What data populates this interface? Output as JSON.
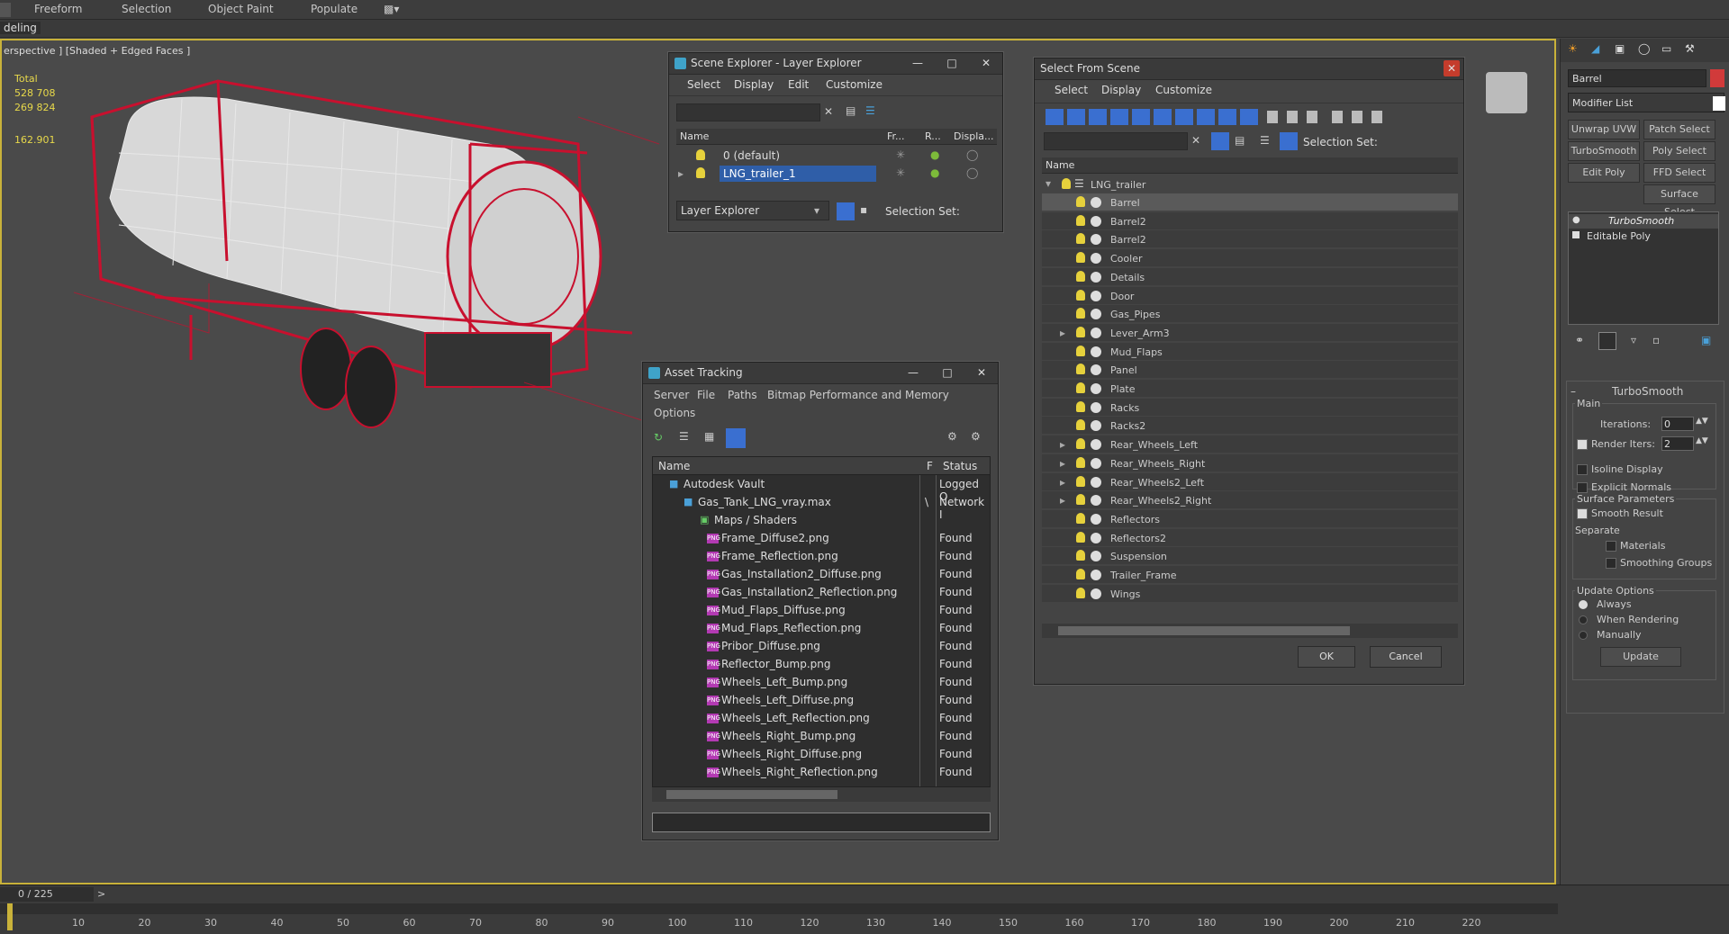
{
  "ribbon": {
    "tabs": [
      "Freeform",
      "Selection",
      "Object Paint",
      "Populate"
    ],
    "subtab": "deling"
  },
  "viewport": {
    "label": "erspective ] [Shaded + Edged Faces ]",
    "stats": {
      "total_label": "Total",
      "line1": "528 708",
      "line2": "269 824",
      "fps": "162.901"
    }
  },
  "scene_explorer": {
    "title": "Scene Explorer - Layer Explorer",
    "menu": [
      "Select",
      "Display",
      "Edit",
      "Customize"
    ],
    "columns": [
      "Name",
      "Fr...",
      "R...",
      "Displa..."
    ],
    "rows": [
      "0 (default)",
      "LNG_trailer_1"
    ],
    "footer_dropdown": "Layer Explorer",
    "selection_set": "Selection Set:"
  },
  "asset_tracking": {
    "title": "Asset Tracking",
    "menu": [
      "Server",
      "File",
      "Paths",
      "Bitmap Performance and Memory",
      "Options"
    ],
    "columns": [
      "Name",
      "F",
      "Status"
    ],
    "rows": [
      {
        "name": "Autodesk Vault",
        "f": "",
        "status": "Logged O"
      },
      {
        "name": "Gas_Tank_LNG_vray.max",
        "f": "\\",
        "status": "Network I"
      },
      {
        "name": "Maps / Shaders",
        "f": "",
        "status": ""
      },
      {
        "name": "Frame_Diffuse2.png",
        "f": "",
        "status": "Found"
      },
      {
        "name": "Frame_Reflection.png",
        "f": "",
        "status": "Found"
      },
      {
        "name": "Gas_Installation2_Diffuse.png",
        "f": "",
        "status": "Found"
      },
      {
        "name": "Gas_Installation2_Reflection.png",
        "f": "",
        "status": "Found"
      },
      {
        "name": "Mud_Flaps_Diffuse.png",
        "f": "",
        "status": "Found"
      },
      {
        "name": "Mud_Flaps_Reflection.png",
        "f": "",
        "status": "Found"
      },
      {
        "name": "Pribor_Diffuse.png",
        "f": "",
        "status": "Found"
      },
      {
        "name": "Reflector_Bump.png",
        "f": "",
        "status": "Found"
      },
      {
        "name": "Wheels_Left_Bump.png",
        "f": "",
        "status": "Found"
      },
      {
        "name": "Wheels_Left_Diffuse.png",
        "f": "",
        "status": "Found"
      },
      {
        "name": "Wheels_Left_Reflection.png",
        "f": "",
        "status": "Found"
      },
      {
        "name": "Wheels_Right_Bump.png",
        "f": "",
        "status": "Found"
      },
      {
        "name": "Wheels_Right_Diffuse.png",
        "f": "",
        "status": "Found"
      },
      {
        "name": "Wheels_Right_Reflection.png",
        "f": "",
        "status": "Found"
      }
    ]
  },
  "select_from_scene": {
    "title": "Select From Scene",
    "menu": [
      "Select",
      "Display",
      "Customize"
    ],
    "selection_set": "Selection Set:",
    "column": "Name",
    "root": "LNG_trailer",
    "items": [
      "Barrel",
      "Barrel2",
      "Barrel2",
      "Cooler",
      "Details",
      "Door",
      "Gas_Pipes",
      "Lever_Arm3",
      "Mud_Flaps",
      "Panel",
      "Plate",
      "Racks",
      "Racks2",
      "Rear_Wheels_Left",
      "Rear_Wheels_Right",
      "Rear_Wheels2_Left",
      "Rear_Wheels2_Right",
      "Reflectors",
      "Reflectors2",
      "Suspension",
      "Trailer_Frame",
      "Wings"
    ],
    "ok": "OK",
    "cancel": "Cancel"
  },
  "command_panel": {
    "object_name": "Barrel",
    "modifier_list": "Modifier List",
    "buttons": [
      "Unwrap UVW",
      "Patch Select",
      "TurboSmooth",
      "Poly Select",
      "Edit Poly",
      "FFD Select",
      "Surface Select"
    ],
    "stack": [
      "TurboSmooth",
      "Editable Poly"
    ],
    "rollout_title": "TurboSmooth",
    "main": "Main",
    "iterations_label": "Iterations:",
    "iterations": "0",
    "render_iters_label": "Render Iters:",
    "render_iters": "2",
    "isoline": "Isoline Display",
    "explicit": "Explicit Normals",
    "surface_params": "Surface Parameters",
    "smooth_result": "Smooth Result",
    "separate": "Separate",
    "materials": "Materials",
    "smoothing_groups": "Smoothing Groups",
    "update_options": "Update Options",
    "always": "Always",
    "when_rendering": "When Rendering",
    "manually": "Manually",
    "update": "Update"
  },
  "timeline": {
    "frame": "0 / 225",
    "ticks": [
      "10",
      "20",
      "30",
      "40",
      "50",
      "60",
      "70",
      "80",
      "90",
      "100",
      "110",
      "120",
      "130",
      "140",
      "150",
      "160",
      "170",
      "180",
      "190",
      "200",
      "210",
      "220"
    ]
  },
  "colors": {
    "accent": "#3a6fd0",
    "wire": "#c8102e",
    "viewport_border": "#c9b23a"
  }
}
